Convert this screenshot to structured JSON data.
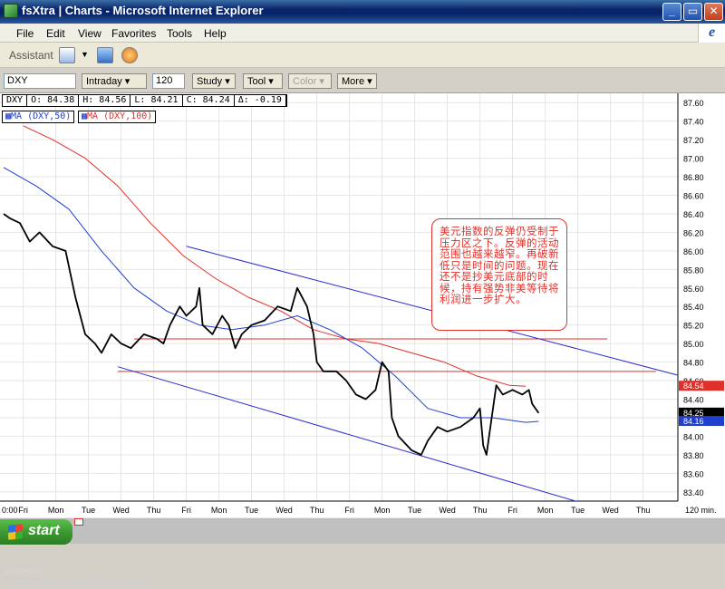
{
  "window": {
    "title": "fsXtra | Charts - Microsoft Internet Explorer",
    "controls": [
      "_",
      "▭",
      "✕"
    ]
  },
  "menu": [
    "File",
    "Edit",
    "View",
    "Favorites",
    "Tools",
    "Help"
  ],
  "toolbar": {
    "assistant_label": "Assistant"
  },
  "chart_toolbar": {
    "symbol": "DXY",
    "period": "Intraday",
    "interval": "120",
    "buttons": [
      "Study",
      "Tool",
      "Color",
      "More"
    ]
  },
  "legend": {
    "symbol": "DXY",
    "open": "O: 84.38",
    "high": "H: 84.56",
    "low": "L: 84.21",
    "close": "C: 84.24",
    "change": "Δ: -0.19",
    "ma50": "MA (DXY,50)",
    "ma100": "MA (DXY,100)"
  },
  "annotation": "美元指数的反弹仍受制于压力区之下。反弹的活动范围也越来越窄。再破新低只是时间的问题。现在还不是抄美元底部的时候，持有强势非美等待将利润进一步扩大。",
  "watermark": {
    "text": "futuresourceXtra.com",
    "small": "powered by"
  },
  "taskbar": {
    "start_label": "start"
  },
  "colors": {
    "price": "#000000",
    "ma50": "#1f3fd0",
    "ma100": "#e0302a",
    "channel": "#2a2ad0",
    "resistance": "#e0302a"
  },
  "chart_data": {
    "type": "line",
    "title": "",
    "interval_label": "120 min.",
    "x_categories": [
      "Fri",
      "Mon",
      "Tue",
      "Wed",
      "Thu",
      "Fri",
      "Mon",
      "Tue",
      "Wed",
      "Thu",
      "Fri",
      "Mon",
      "Tue",
      "Wed",
      "Thu",
      "Fri",
      "Mon",
      "Tue",
      "Wed",
      "Thu"
    ],
    "first_x_label": "0:00",
    "ylim": [
      83.3,
      87.7
    ],
    "y_ticks": [
      "87.60",
      "87.40",
      "87.20",
      "87.00",
      "86.80",
      "86.60",
      "86.40",
      "86.20",
      "86.00",
      "85.80",
      "85.60",
      "85.40",
      "85.20",
      "85.00",
      "84.80",
      "84.60",
      "84.40",
      "84.20",
      "84.00",
      "83.80",
      "83.60",
      "83.40"
    ],
    "last_values": [
      {
        "label": "84.54",
        "series": "MA (DXY,100)",
        "color": "#e0302a"
      },
      {
        "label": "84.25",
        "series": "DXY",
        "color": "#000000"
      },
      {
        "label": "84.16",
        "series": "MA (DXY,50)",
        "color": "#1f3fd0"
      }
    ],
    "price": {
      "name": "DXY",
      "points": [
        [
          0,
          86.4
        ],
        [
          0.2,
          86.35
        ],
        [
          0.5,
          86.3
        ],
        [
          0.8,
          86.1
        ],
        [
          1.1,
          86.2
        ],
        [
          1.5,
          86.05
        ],
        [
          1.9,
          86.0
        ],
        [
          2.2,
          85.5
        ],
        [
          2.5,
          85.1
        ],
        [
          2.8,
          85.0
        ],
        [
          3.0,
          84.9
        ],
        [
          3.3,
          85.1
        ],
        [
          3.6,
          85.0
        ],
        [
          3.9,
          84.95
        ],
        [
          4.3,
          85.1
        ],
        [
          4.7,
          85.05
        ],
        [
          4.9,
          85.0
        ],
        [
          5.1,
          85.2
        ],
        [
          5.4,
          85.4
        ],
        [
          5.6,
          85.3
        ],
        [
          5.9,
          85.4
        ],
        [
          6.0,
          85.6
        ],
        [
          6.1,
          85.2
        ],
        [
          6.4,
          85.1
        ],
        [
          6.7,
          85.3
        ],
        [
          6.9,
          85.2
        ],
        [
          7.1,
          84.95
        ],
        [
          7.3,
          85.1
        ],
        [
          7.6,
          85.2
        ],
        [
          8.0,
          85.25
        ],
        [
          8.4,
          85.4
        ],
        [
          8.8,
          85.35
        ],
        [
          9.0,
          85.6
        ],
        [
          9.3,
          85.4
        ],
        [
          9.5,
          85.1
        ],
        [
          9.6,
          84.8
        ],
        [
          9.8,
          84.7
        ],
        [
          10.2,
          84.7
        ],
        [
          10.5,
          84.6
        ],
        [
          10.8,
          84.45
        ],
        [
          11.1,
          84.4
        ],
        [
          11.4,
          84.5
        ],
        [
          11.6,
          84.8
        ],
        [
          11.8,
          84.7
        ],
        [
          11.9,
          84.2
        ],
        [
          12.1,
          84.0
        ],
        [
          12.5,
          83.85
        ],
        [
          12.8,
          83.8
        ],
        [
          13.0,
          83.95
        ],
        [
          13.3,
          84.1
        ],
        [
          13.6,
          84.05
        ],
        [
          14.0,
          84.1
        ],
        [
          14.4,
          84.2
        ],
        [
          14.6,
          84.3
        ],
        [
          14.7,
          83.9
        ],
        [
          14.8,
          83.8
        ],
        [
          15.0,
          84.3
        ],
        [
          15.1,
          84.55
        ],
        [
          15.3,
          84.45
        ],
        [
          15.6,
          84.5
        ],
        [
          15.9,
          84.45
        ],
        [
          16.1,
          84.5
        ],
        [
          16.2,
          84.35
        ],
        [
          16.4,
          84.25
        ]
      ]
    },
    "ma50": {
      "name": "MA (DXY,50)",
      "points": [
        [
          0,
          86.9
        ],
        [
          1.0,
          86.7
        ],
        [
          2.0,
          86.45
        ],
        [
          3.0,
          86.0
        ],
        [
          4.0,
          85.6
        ],
        [
          5.0,
          85.35
        ],
        [
          6.0,
          85.2
        ],
        [
          7.0,
          85.15
        ],
        [
          8.0,
          85.2
        ],
        [
          9.0,
          85.3
        ],
        [
          10.0,
          85.15
        ],
        [
          11.0,
          84.95
        ],
        [
          12.0,
          84.65
        ],
        [
          13.0,
          84.3
        ],
        [
          14.0,
          84.2
        ],
        [
          15.0,
          84.2
        ],
        [
          16.0,
          84.15
        ],
        [
          16.4,
          84.16
        ]
      ]
    },
    "ma100": {
      "name": "MA (DXY,100)",
      "points": [
        [
          0.6,
          87.35
        ],
        [
          1.5,
          87.2
        ],
        [
          2.5,
          87.0
        ],
        [
          3.5,
          86.7
        ],
        [
          4.5,
          86.3
        ],
        [
          5.5,
          85.95
        ],
        [
          6.5,
          85.7
        ],
        [
          7.5,
          85.5
        ],
        [
          8.5,
          85.35
        ],
        [
          9.5,
          85.15
        ],
        [
          10.5,
          85.05
        ],
        [
          11.5,
          85.0
        ],
        [
          12.5,
          84.9
        ],
        [
          13.5,
          84.8
        ],
        [
          14.5,
          84.65
        ],
        [
          15.5,
          84.55
        ],
        [
          16.0,
          84.54
        ]
      ]
    },
    "channel_lines": [
      {
        "from": [
          5.6,
          86.05
        ],
        "to": [
          21.3,
          84.6
        ]
      },
      {
        "from": [
          3.5,
          84.75
        ],
        "to": [
          18.5,
          83.2
        ]
      }
    ],
    "resistance_lines": [
      {
        "y": 85.05,
        "from_x": 4.0,
        "to_x": 18.5
      },
      {
        "y": 84.7,
        "from_x": 3.5,
        "to_x": 20.0
      }
    ]
  }
}
